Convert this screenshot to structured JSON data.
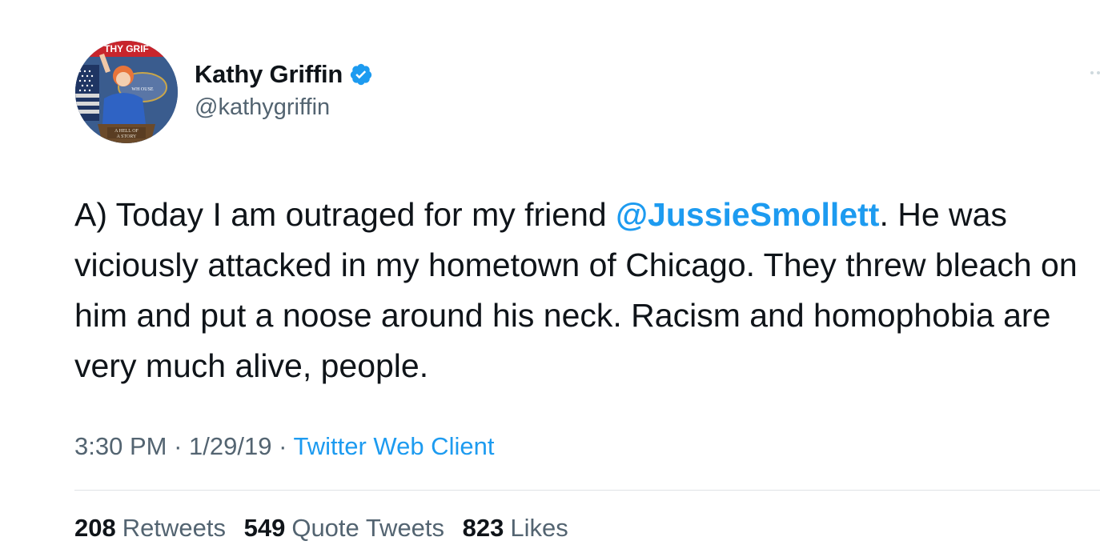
{
  "author": {
    "display_name": "Kathy Griffin",
    "handle": "@kathygriffin",
    "verified_icon": "verified-badge-icon",
    "avatar": {
      "banner_text": "THY GRIF",
      "podium_text_line1": "A HELL OF",
      "podium_text_line2": "A STORY",
      "seal_text": "WH OUSE"
    }
  },
  "tweet": {
    "text_before_mention": "A) Today I am outraged for my friend ",
    "mention": "@JussieSmollett",
    "text_after_mention": ".  He was viciously attacked in my hometown of Chicago. They threw bleach on him and put a noose around his neck. Racism and homophobia are very much alive, people."
  },
  "meta": {
    "time": "3:30 PM",
    "separator": "·",
    "date": "1/29/19",
    "client": "Twitter Web Client"
  },
  "stats": {
    "retweets_count": "208",
    "retweets_label": "Retweets",
    "quote_tweets_count": "549",
    "quote_tweets_label": "Quote Tweets",
    "likes_count": "823",
    "likes_label": "Likes"
  },
  "colors": {
    "accent": "#1d9bf0",
    "text_primary": "#0f1419",
    "text_secondary": "#536471",
    "divider": "#dfe3e6"
  }
}
